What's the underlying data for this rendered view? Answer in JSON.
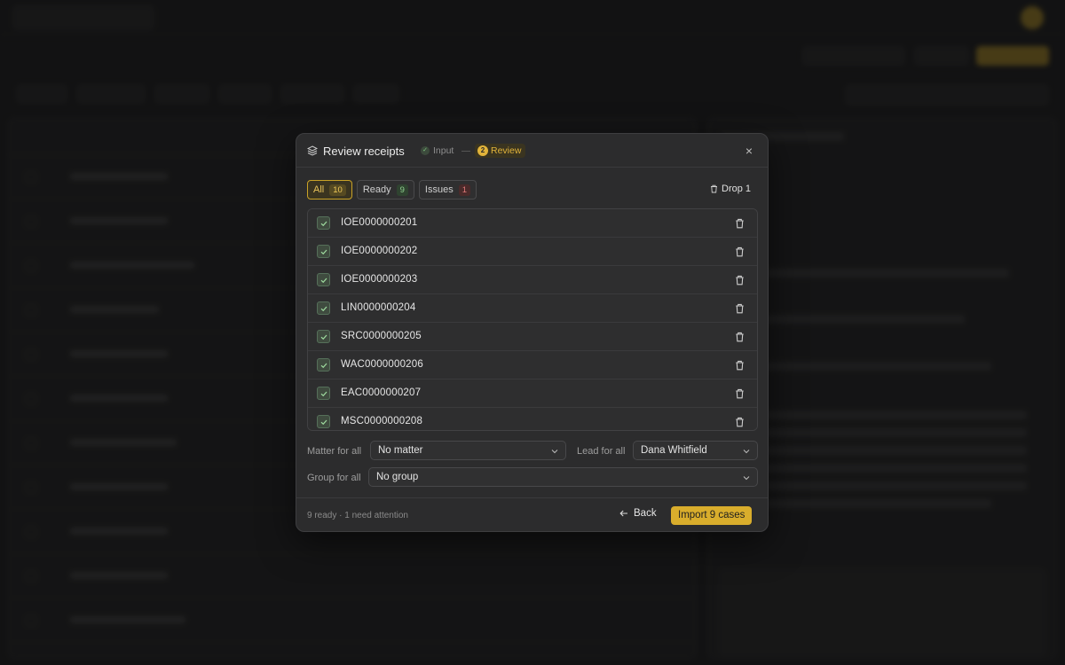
{
  "modal": {
    "title": "Review receipts",
    "steps": {
      "input": "Input",
      "review_num": "2",
      "review": "Review"
    },
    "tabs": [
      {
        "label": "All",
        "count": "10"
      },
      {
        "label": "Ready",
        "count": "9"
      },
      {
        "label": "Issues",
        "count": "1"
      }
    ],
    "drop_label": "Drop 1",
    "receipts": [
      "IOE0000000201",
      "IOE0000000202",
      "IOE0000000203",
      "LIN0000000204",
      "SRC0000000205",
      "WAC0000000206",
      "EAC0000000207",
      "MSC0000000208"
    ],
    "matter_label": "Matter for all",
    "matter_value": "No matter",
    "lead_label": "Lead for all",
    "lead_value": "Dana Whitfield",
    "group_label": "Group for all",
    "group_value": "No group",
    "status": "9 ready · 1 need attention",
    "back_label": "Back",
    "import_label": "Import 9 cases"
  },
  "colors": {
    "accent": "#d9ad2c",
    "ready_green": "#8fcf8f",
    "issue_red": "#e07a7a"
  }
}
